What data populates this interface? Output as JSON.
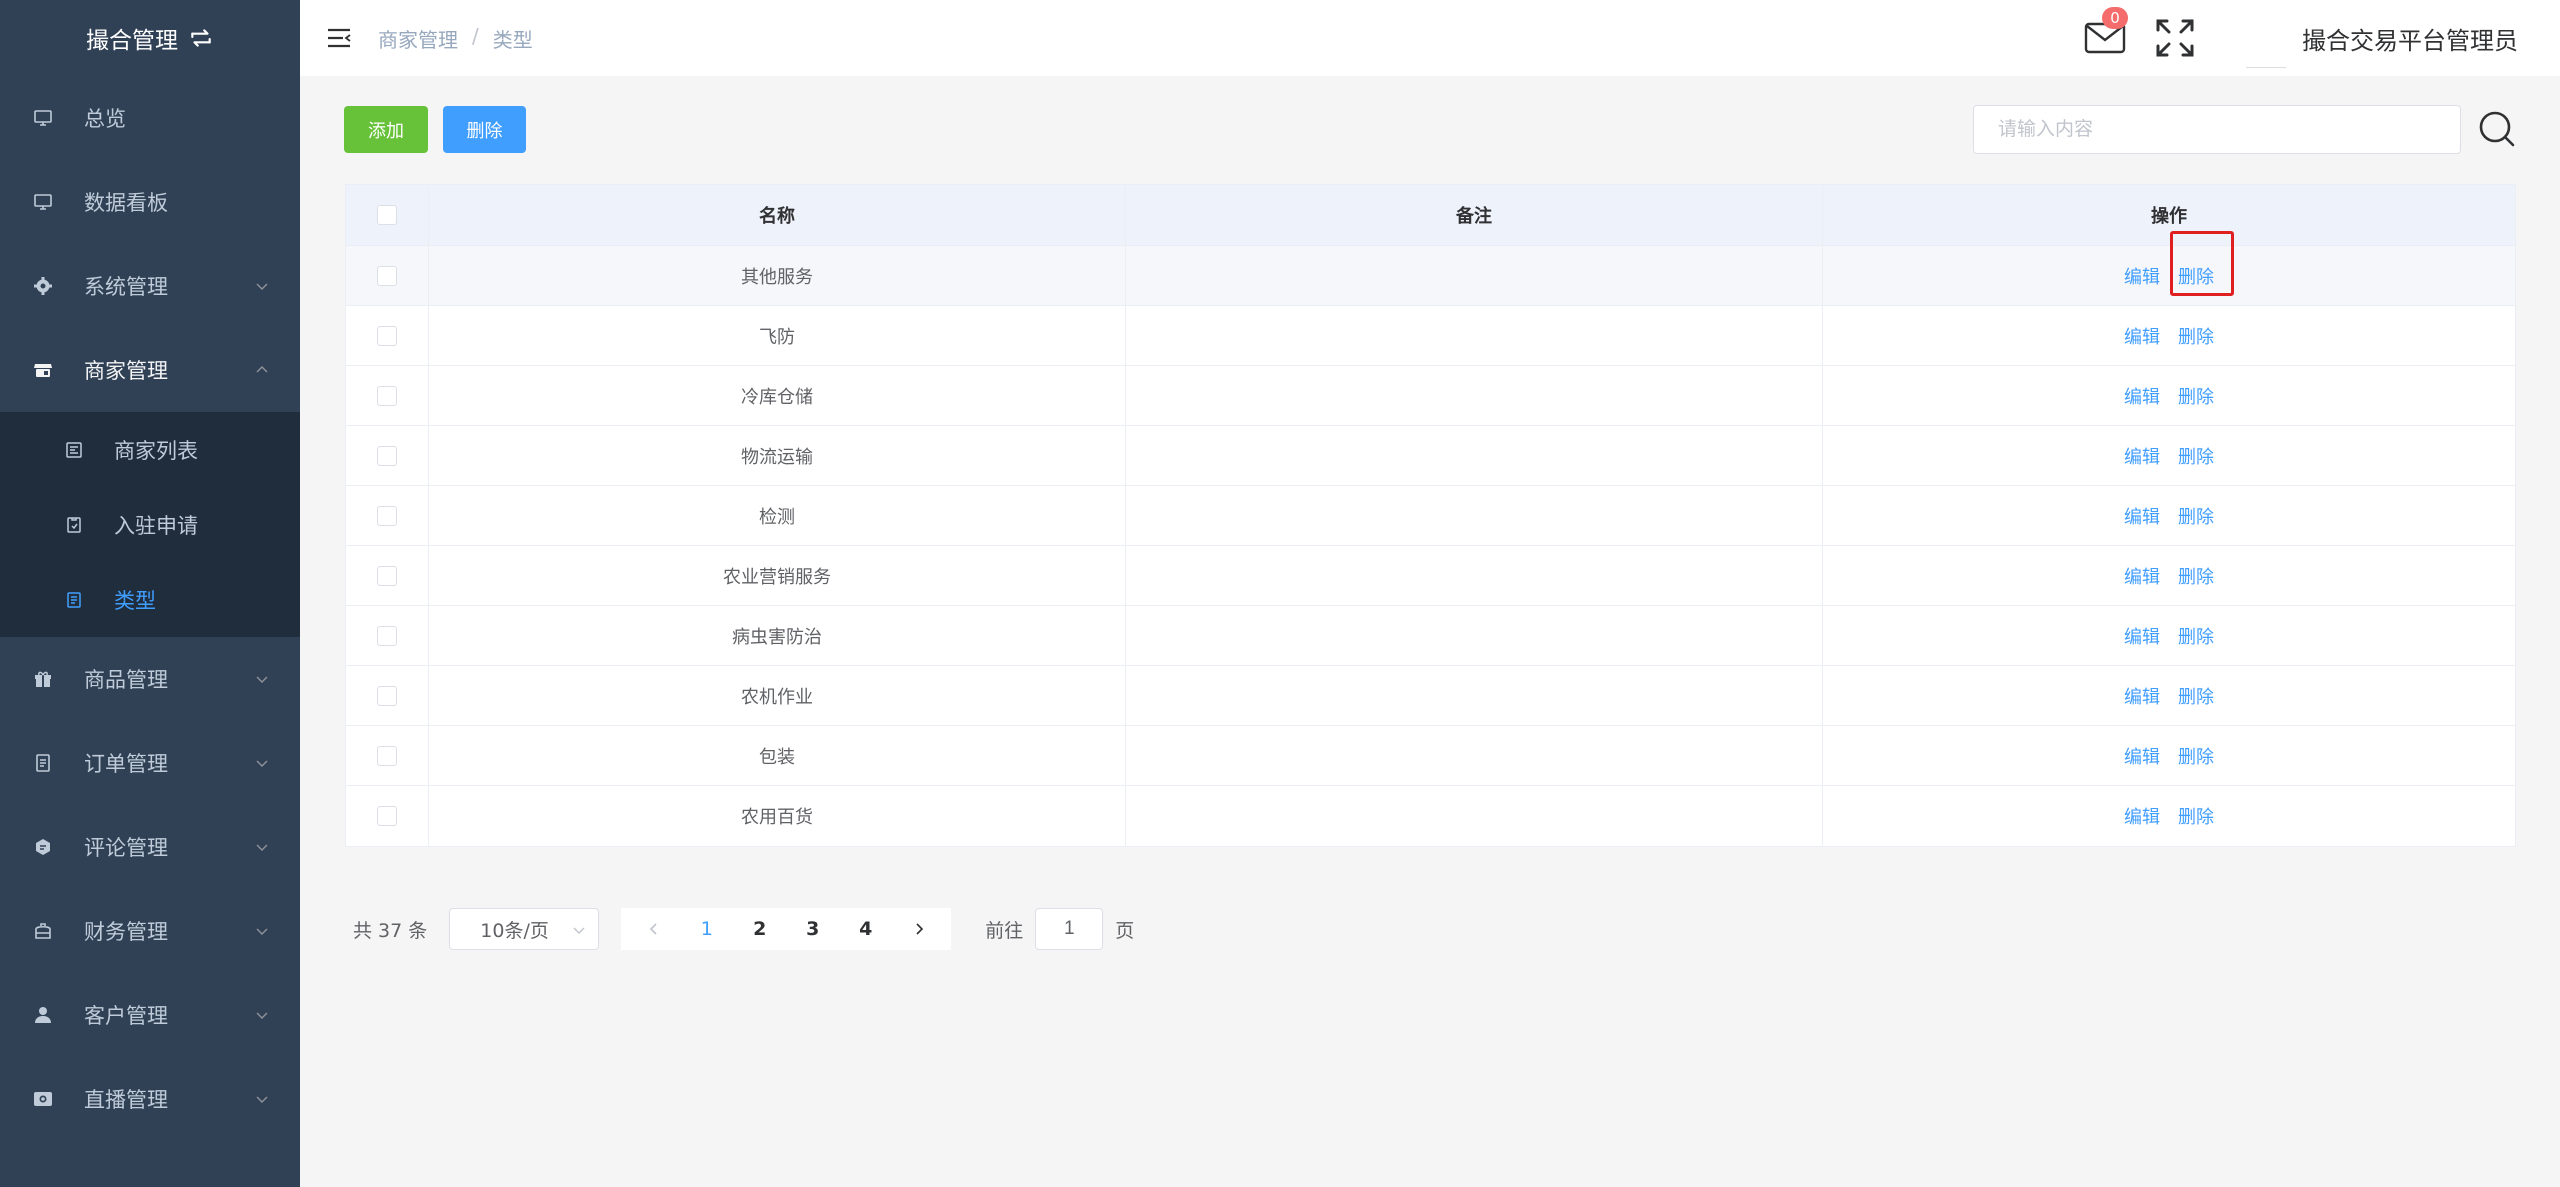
{
  "sidebar": {
    "brand": "撮合管理",
    "menu": [
      {
        "label": "总览"
      },
      {
        "label": "数据看板"
      },
      {
        "label": "系统管理"
      },
      {
        "label": "商家管理"
      }
    ],
    "submenu": [
      {
        "label": "商家列表"
      },
      {
        "label": "入驻申请"
      },
      {
        "label": "类型"
      }
    ],
    "menu2": [
      {
        "label": "商品管理"
      },
      {
        "label": "订单管理"
      },
      {
        "label": "评论管理"
      },
      {
        "label": "财务管理"
      },
      {
        "label": "客户管理"
      },
      {
        "label": "直播管理"
      }
    ]
  },
  "header": {
    "breadcrumb": [
      "商家管理",
      "类型"
    ],
    "breadcrumb_sep": "/",
    "message_count": "0",
    "username": "撮合交易平台管理员"
  },
  "toolbar": {
    "add_label": "添加",
    "delete_label": "删除",
    "search_placeholder": "请输入内容"
  },
  "table": {
    "columns": [
      "名称",
      "备注",
      "操作"
    ],
    "edit_label": "编辑",
    "delete_label": "删除",
    "rows": [
      {
        "name": "其他服务",
        "note": ""
      },
      {
        "name": "飞防",
        "note": ""
      },
      {
        "name": "冷库仓储",
        "note": ""
      },
      {
        "name": "物流运输",
        "note": ""
      },
      {
        "name": "检测",
        "note": ""
      },
      {
        "name": "农业营销服务",
        "note": ""
      },
      {
        "name": "病虫害防治",
        "note": ""
      },
      {
        "name": "农机作业",
        "note": ""
      },
      {
        "name": "包装",
        "note": ""
      },
      {
        "name": "农用百货",
        "note": ""
      }
    ]
  },
  "pagination": {
    "total": "共 37 条",
    "page_size": "10条/页",
    "pages": [
      "1",
      "2",
      "3",
      "4"
    ],
    "current": "1",
    "goto_prefix": "前往",
    "goto_value": "1",
    "goto_suffix": "页"
  },
  "colors": {
    "sidebar_bg": "#304156",
    "submenu_bg": "#1f2d3d",
    "primary": "#409eff",
    "success": "#67c23a",
    "danger": "#f56c6c",
    "highlight_box": "#e02020"
  },
  "icons": {
    "brand": "switch-icon",
    "header": [
      "menu-fold-icon",
      "mail-icon",
      "fullscreen-icon",
      "search-icon"
    ]
  }
}
